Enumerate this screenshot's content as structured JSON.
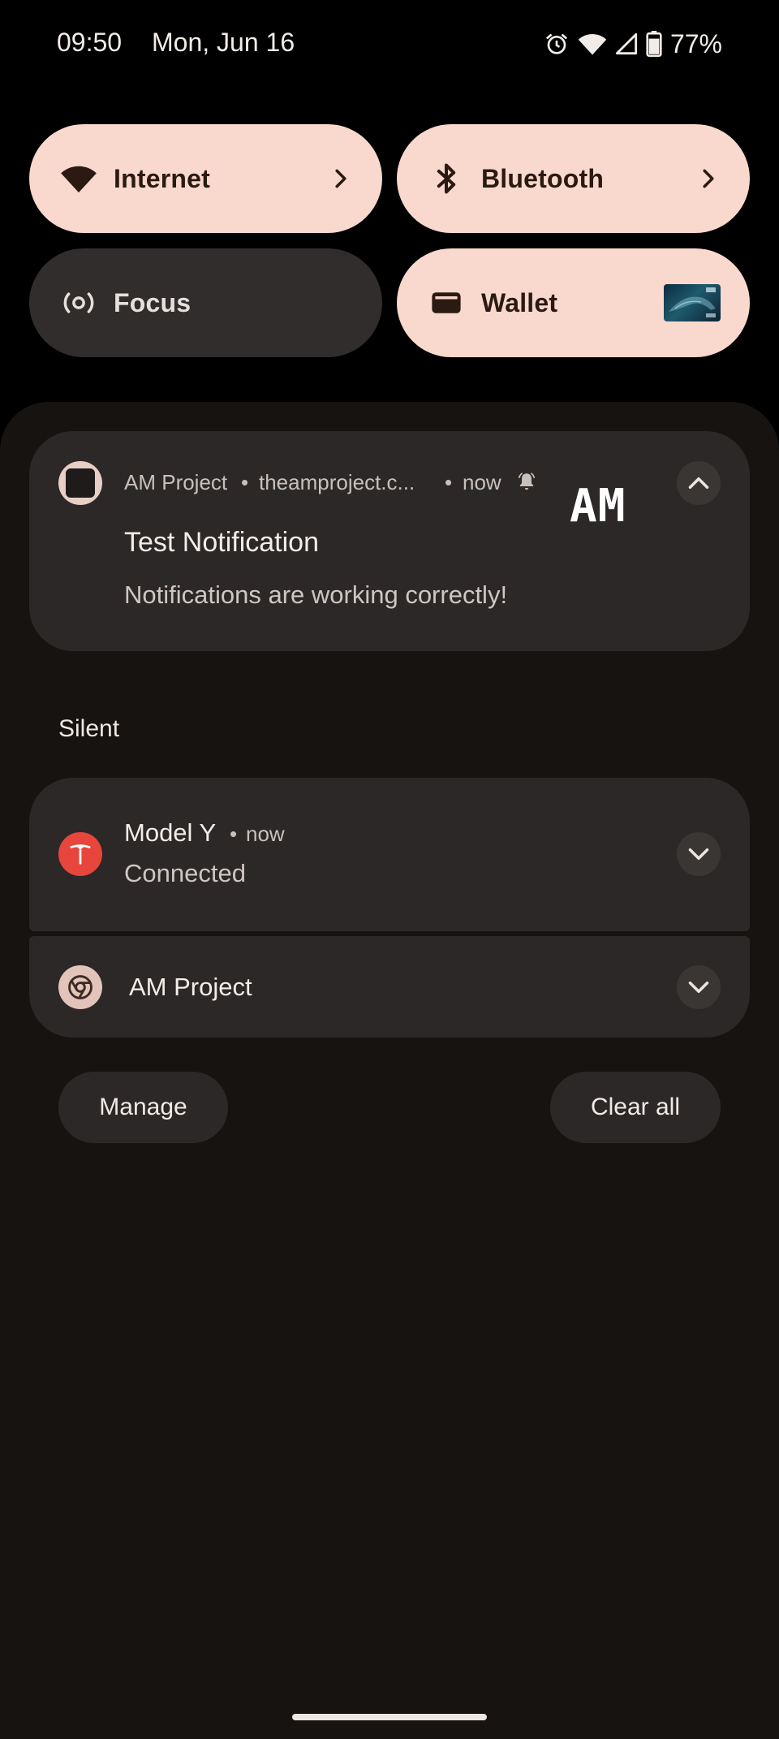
{
  "status_bar": {
    "time": "09:50",
    "date": "Mon, Jun 16",
    "battery": "77%",
    "icons": [
      "alarm-icon",
      "wifi-icon",
      "cell-signal-icon",
      "battery-icon"
    ]
  },
  "quick_settings": {
    "tiles": [
      {
        "label": "Internet",
        "icon": "wifi-icon",
        "state": "active",
        "has_chevron": true
      },
      {
        "label": "Bluetooth",
        "icon": "bluetooth-icon",
        "state": "active",
        "has_chevron": true
      },
      {
        "label": "Focus",
        "icon": "focus-icon",
        "state": "inactive",
        "has_chevron": false
      },
      {
        "label": "Wallet",
        "icon": "wallet-icon",
        "state": "active",
        "has_card_thumbnail": true
      }
    ]
  },
  "notifications": {
    "expanded": {
      "app_name": "AM Project",
      "separator": "•",
      "source": "theamproject.c...",
      "time": "now",
      "large_icon_text": "AM",
      "title": "Test Notification",
      "body": "Notifications are working correctly!"
    },
    "section_header": "Silent",
    "silent": [
      {
        "app_name": "Model Y",
        "time": "now",
        "text": "Connected",
        "icon": "tesla-logo-icon",
        "accent": "#E8453C"
      },
      {
        "app_name": "AM Project",
        "icon": "chrome-icon",
        "accent": "#E3C4BA"
      }
    ],
    "actions": {
      "manage": "Manage",
      "clear_all": "Clear all"
    }
  },
  "colors": {
    "tile_active": "#F9D9CD",
    "tile_inactive": "#302D2C",
    "shade_bg": "#171311",
    "card_bg": "#2C2827"
  }
}
